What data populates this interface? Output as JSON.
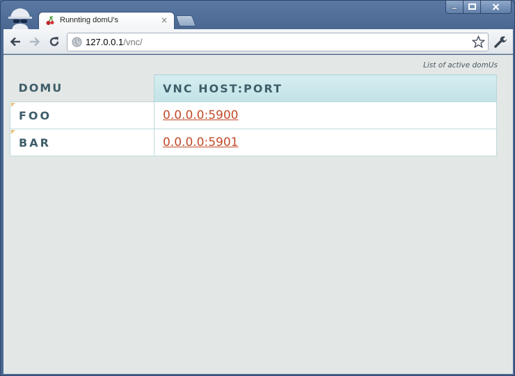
{
  "browser": {
    "tab": {
      "title": "Runnting domU's",
      "favicon": "cherry-icon",
      "close_label": "×"
    },
    "window_buttons": {
      "minimize": "minimize-icon",
      "maximize": "maximize-icon",
      "close": "close-icon"
    },
    "toolbar": {
      "back": "back-arrow-icon",
      "forward": "forward-arrow-icon",
      "reload": "reload-icon",
      "url_host": "127.0.0.1",
      "url_path": "/vnc/",
      "bookmark": "star-icon",
      "menu": "wrench-icon"
    }
  },
  "page": {
    "caption": "List of active domUs",
    "table": {
      "headers": [
        "DOMU",
        "VNC HOST:PORT"
      ],
      "rows": [
        {
          "name": "FOO",
          "link": "0.0.0.0:5900"
        },
        {
          "name": "BAR",
          "link": "0.0.0.0:5901"
        }
      ]
    }
  },
  "colors": {
    "link": "#c24a2a",
    "header_bg": "#c9e7ea",
    "page_bg": "#e3e7e6",
    "text": "#3e5e6a"
  }
}
